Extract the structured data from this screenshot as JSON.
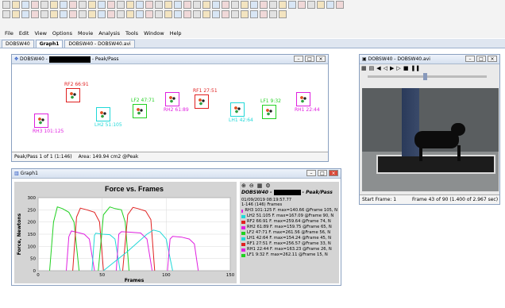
{
  "menu": [
    "File",
    "Edit",
    "View",
    "Options",
    "Movie",
    "Analysis",
    "Tools",
    "Window",
    "Help"
  ],
  "tabs": [
    "DOBSW40",
    "Graph1",
    "DOBSW40 - DOBSW40.avi"
  ],
  "peak_window": {
    "title_left": "DOBSW40 -",
    "title_right": "- Peak/Pass",
    "markers": [
      {
        "label": "RH3 101:125",
        "color": "#e020e0",
        "dir": "below"
      },
      {
        "label": "RF2 66:91",
        "color": "#e02020",
        "dir": "above"
      },
      {
        "label": "LH2 51:105",
        "color": "#20d8d8",
        "dir": "below"
      },
      {
        "label": "LF2 47:71",
        "color": "#20d020",
        "dir": "above"
      },
      {
        "label": "RH2 61:89",
        "color": "#e020e0",
        "dir": "below"
      },
      {
        "label": "RF1 27:51",
        "color": "#e02020",
        "dir": "above"
      },
      {
        "label": "LH1 42:64",
        "color": "#20d8d8",
        "dir": "below"
      },
      {
        "label": "LF1 9:32",
        "color": "#20d020",
        "dir": "above"
      },
      {
        "label": "RH1 22:44",
        "color": "#e020e0",
        "dir": "below"
      }
    ],
    "status_left": "Peak/Pass 1 of 1 (1:146)",
    "status_right": "Area: 149.94 cm2 @Peak"
  },
  "video_window": {
    "title": "DOBSW40 - DOBSW40.avi",
    "start_frame": "Start Frame: 1",
    "frame_info": "Frame 43 of 90  (1.400 of 2.967 sec)"
  },
  "graph_window": {
    "title": "Graph1",
    "panel_title_left": "DOBSW40 -",
    "panel_title_right": "- Peak/Pass",
    "date": "01/09/2019 08:19:57.77",
    "frames": "1-146 (146) Frames",
    "legend": [
      {
        "text": "RH3 101:125 F. max=140.66 @Frame 105, N",
        "color": "#e020e0"
      },
      {
        "text": "LH2 51:105 F. max=167.09 @Frame 90, N",
        "color": "#20d8d8"
      },
      {
        "text": "RF2 66:91 F. max=259.64 @Frame 74, N",
        "color": "#e02020"
      },
      {
        "text": "RH2 61:89 F. max=159.75 @Frame 65, N",
        "color": "#e020e0"
      },
      {
        "text": "LF2 47:71 F. max=261.56 @Frame 56, N",
        "color": "#20d020"
      },
      {
        "text": "LH1 42:64 F. max=154.24 @Frame 45, N",
        "color": "#20d8d8"
      },
      {
        "text": "RF1 27:51 F. max=256.57 @Frame 33, N",
        "color": "#e02020"
      },
      {
        "text": "RH1 22:44 F. max=163.23 @Frame 26, N",
        "color": "#e020e0"
      },
      {
        "text": "LF1 9:32 F. max=262.11 @Frame 15, N",
        "color": "#20d020"
      }
    ]
  },
  "chart_data": {
    "type": "line",
    "title": "Force vs. Frames",
    "xlabel": "Frames",
    "ylabel": "Force, Newtons",
    "xlim": [
      0,
      150
    ],
    "ylim": [
      0,
      300
    ],
    "xticks": [
      0,
      50,
      100,
      150
    ],
    "yticks": [
      0,
      50,
      100,
      150,
      200,
      250,
      300
    ],
    "grid": true,
    "series": [
      {
        "name": "LF1",
        "color": "#20d020",
        "x": [
          9,
          12,
          15,
          19,
          24,
          28,
          32
        ],
        "y": [
          0,
          200,
          262,
          255,
          240,
          200,
          0
        ]
      },
      {
        "name": "RH1",
        "color": "#e020e0",
        "x": [
          22,
          24,
          26,
          30,
          36,
          40,
          44
        ],
        "y": [
          0,
          140,
          163,
          158,
          150,
          130,
          0
        ]
      },
      {
        "name": "RF1",
        "color": "#e02020",
        "x": [
          27,
          30,
          33,
          38,
          44,
          48,
          51
        ],
        "y": [
          0,
          220,
          257,
          250,
          240,
          200,
          0
        ]
      },
      {
        "name": "LH1",
        "color": "#20d8d8",
        "x": [
          42,
          44,
          45,
          50,
          56,
          60,
          64
        ],
        "y": [
          0,
          145,
          154,
          150,
          148,
          130,
          0
        ]
      },
      {
        "name": "LF2",
        "color": "#20d020",
        "x": [
          47,
          51,
          56,
          60,
          65,
          68,
          71
        ],
        "y": [
          0,
          230,
          262,
          255,
          250,
          200,
          0
        ]
      },
      {
        "name": "RH2",
        "color": "#e020e0",
        "x": [
          61,
          63,
          65,
          72,
          80,
          85,
          89
        ],
        "y": [
          0,
          150,
          160,
          158,
          155,
          130,
          0
        ]
      },
      {
        "name": "RF2",
        "color": "#e02020",
        "x": [
          66,
          70,
          74,
          78,
          84,
          88,
          91
        ],
        "y": [
          0,
          230,
          260,
          255,
          245,
          210,
          0
        ]
      },
      {
        "name": "LH2",
        "color": "#20d8d8",
        "x": [
          51,
          70,
          85,
          90,
          95,
          100,
          105
        ],
        "y": [
          0,
          80,
          150,
          167,
          160,
          130,
          0
        ]
      },
      {
        "name": "RH3",
        "color": "#e020e0",
        "x": [
          101,
          103,
          105,
          112,
          118,
          122,
          125
        ],
        "y": [
          0,
          130,
          141,
          138,
          130,
          110,
          0
        ]
      }
    ]
  }
}
